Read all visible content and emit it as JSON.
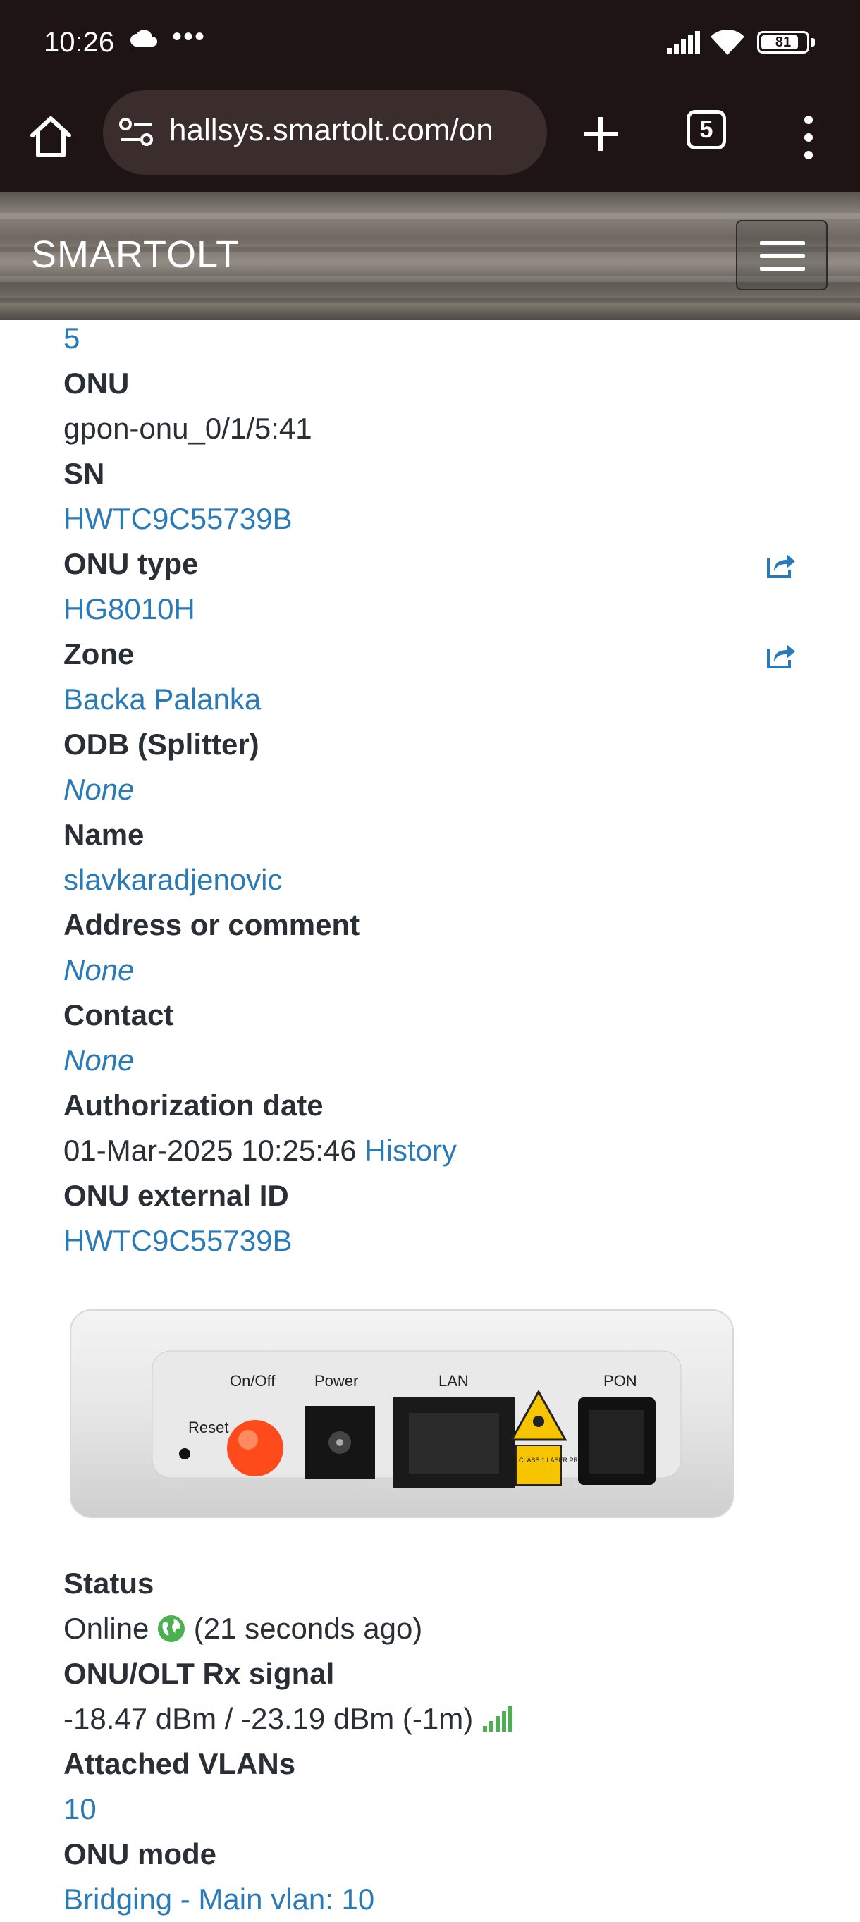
{
  "status_bar": {
    "time": "10:26",
    "battery": "81"
  },
  "browser": {
    "url": "hallsys.smartolt.com/on",
    "tab_count": "5"
  },
  "header": {
    "brand": "SMARTOLT"
  },
  "details": {
    "top_value": "5",
    "onu_label": "ONU",
    "onu_value": "gpon-onu_0/1/5:41",
    "sn_label": "SN",
    "sn_value": "HWTC9C55739B",
    "onu_type_label": "ONU type",
    "onu_type_value": "HG8010H",
    "zone_label": "Zone",
    "zone_value": "Backa Palanka",
    "odb_label": "ODB (Splitter)",
    "odb_value": "None",
    "name_label": "Name",
    "name_value": "slavkaradjenovic",
    "address_label": "Address or comment",
    "address_value": "None",
    "contact_label": "Contact",
    "contact_value": "None",
    "auth_label": "Authorization date",
    "auth_value": "01-Mar-2025 10:25:46",
    "history_link": "History",
    "ext_id_label": "ONU external ID",
    "ext_id_value": "HWTC9C55739B"
  },
  "device_image": {
    "labels": {
      "reset": "Reset",
      "onoff": "On/Off",
      "power": "Power",
      "lan": "LAN",
      "pon": "PON",
      "laser": "CLASS 1 LASER PRODUCT"
    }
  },
  "status": {
    "status_label": "Status",
    "status_value": "Online",
    "status_ago": "(21 seconds ago)",
    "rx_label": "ONU/OLT Rx signal",
    "rx_value": "-18.47 dBm / -23.19 dBm (-1m)",
    "vlans_label": "Attached VLANs",
    "vlans_value": "10",
    "mode_label": "ONU mode",
    "mode_value": "Bridging - Main vlan: 10"
  },
  "colors": {
    "link": "#2a7ab8",
    "text": "#2a2f35",
    "online": "#4caf50",
    "signal": "#4caf50",
    "chrome": "#1e1413"
  }
}
